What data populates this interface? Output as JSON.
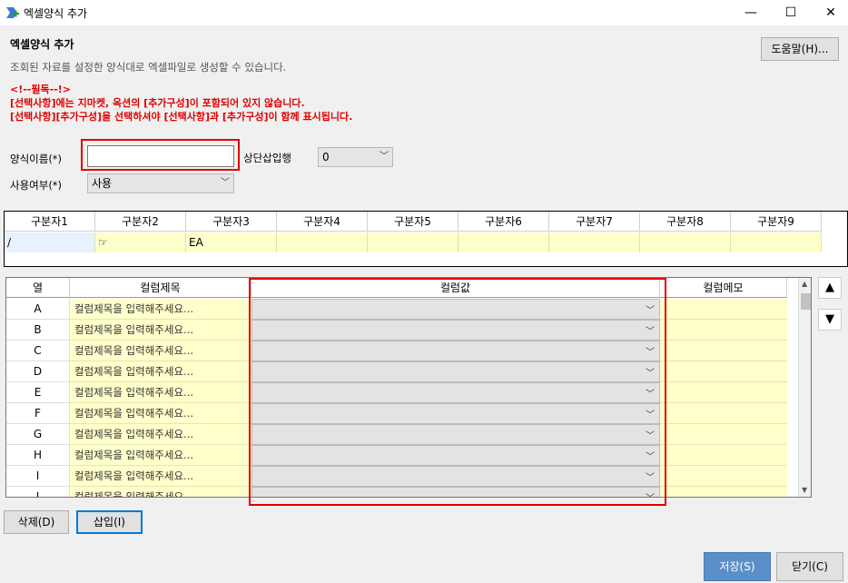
{
  "window": {
    "title": "엑셀양식 추가",
    "minimize": "—",
    "maximize": "☐",
    "close": "✕"
  },
  "header": {
    "title": "엑셀양식 추가",
    "description": "조회된 자료를 설정한 양식대로 엑셀파일로 생성할 수 있습니다.",
    "help_button": "도움말(H)..."
  },
  "notice": {
    "line1": "<!--필독--!>",
    "line2": "[선택사항]에는 지마켓, 옥션의 [추가구성]이 포함되어 있지 않습니다.",
    "line3": "[선택사항][추가구성]을 선택하셔야 [선택사항]과 [추가구성]이 함께 표시됩니다."
  },
  "form": {
    "template_name_label": "양식이름(*)",
    "template_name_value": "",
    "top_insert_label": "상단삽입행",
    "top_insert_value": "0",
    "use_label": "사용여부(*)",
    "use_value": "사용"
  },
  "separators": {
    "headers": [
      "구분자1",
      "구분자2",
      "구분자3",
      "구분자4",
      "구분자5",
      "구분자6",
      "구분자7",
      "구분자8",
      "구분자9"
    ],
    "values": [
      "/",
      "☞",
      "EA",
      "",
      "",
      "",
      "",
      "",
      ""
    ]
  },
  "columns": {
    "headers": {
      "col": "열",
      "title": "컬럼제목",
      "value": "컬럼값",
      "memo": "컬럼메모"
    },
    "rows": [
      {
        "letter": "A",
        "title": "컬럼제목을 입력해주세요..."
      },
      {
        "letter": "B",
        "title": "컬럼제목을 입력해주세요..."
      },
      {
        "letter": "C",
        "title": "컬럼제목을 입력해주세요..."
      },
      {
        "letter": "D",
        "title": "컬럼제목을 입력해주세요..."
      },
      {
        "letter": "E",
        "title": "컬럼제목을 입력해주세요..."
      },
      {
        "letter": "F",
        "title": "컬럼제목을 입력해주세요..."
      },
      {
        "letter": "G",
        "title": "컬럼제목을 입력해주세요..."
      },
      {
        "letter": "H",
        "title": "컬럼제목을 입력해주세요..."
      },
      {
        "letter": "I",
        "title": "컬럼제목을 입력해주세요..."
      },
      {
        "letter": "J",
        "title": "컬럼제목을 입력해주세요..."
      }
    ]
  },
  "side": {
    "up": "▲",
    "down": "▼"
  },
  "actions": {
    "delete": "삭제(D)",
    "insert": "삽입(I)",
    "save": "저장(S)",
    "close": "닫기(C)"
  },
  "colors": {
    "accent": "#5b8fc9",
    "highlight": "#e00000",
    "cell_yellow": "#ffffcc"
  }
}
